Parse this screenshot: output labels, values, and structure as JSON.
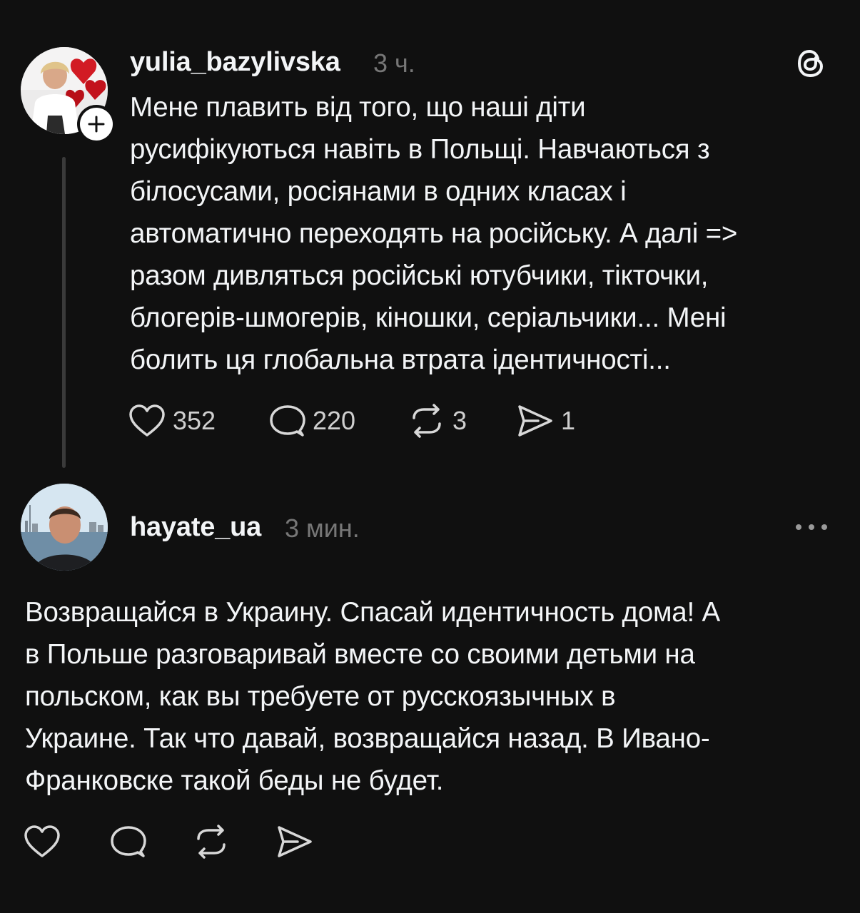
{
  "post": {
    "username": "yulia_bazylivska",
    "time": "3 ч.",
    "text": "Мене плавить від того, що наші діти\nрусифікуються навіть в Польщі. Навчаються з\nбілосусами, росіянами в одних класах і\nавтоматично переходять на російську. А далі =>\nразом дивляться російські ютубчики, тікточки,\nблогерів-шмогерів, кіношки, серіальчики... Мені\nболить ця глобальна втрата ідентичності...",
    "likes": "352",
    "replies": "220",
    "reposts": "3",
    "shares": "1",
    "follow_icon": "plus-icon",
    "app_icon": "threads-logo-icon"
  },
  "reply": {
    "username": "hayate_ua",
    "time": "3 мин.",
    "text": "Возвращайся в Украину. Спасай идентичность дома!  А\nв Польше разговаривай вместе со своими детьми на\nпольском, как вы требуете от русскоязычных в\nУкраине. Так что давай, возвращайся назад. В Ивано-\nФранковске такой беды не будет.",
    "more_icon": "more-dots-icon"
  },
  "colors": {
    "background": "#101010",
    "text": "#f3f5f7",
    "secondary": "#777777"
  }
}
